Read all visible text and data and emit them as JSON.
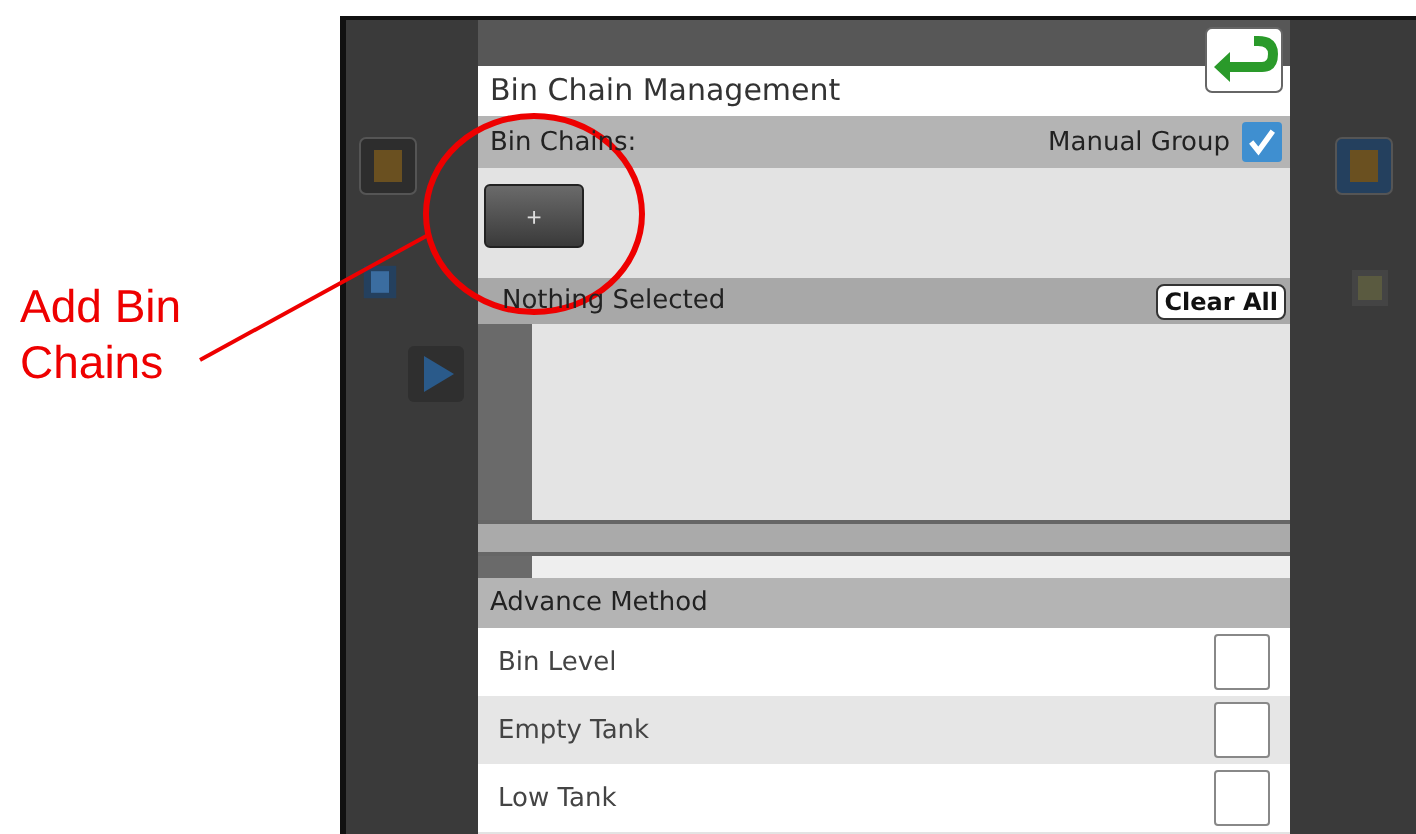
{
  "annotation": {
    "text": "Add Bin Chains"
  },
  "dialog": {
    "title": "Bin Chain Management",
    "bin_chains": {
      "label": "Bin Chains:",
      "manual_group": {
        "label": "Manual Group",
        "checked": true
      },
      "add_button": "+"
    },
    "selection": {
      "label": "Nothing Selected",
      "clear_button": "Clear All"
    },
    "advance_method": {
      "header": "Advance Method",
      "options": [
        {
          "label": "Bin Level",
          "checked": false,
          "selected": false
        },
        {
          "label": "Empty Tank",
          "checked": false,
          "selected": true
        },
        {
          "label": "Low Tank",
          "checked": false,
          "selected": false
        }
      ]
    }
  }
}
